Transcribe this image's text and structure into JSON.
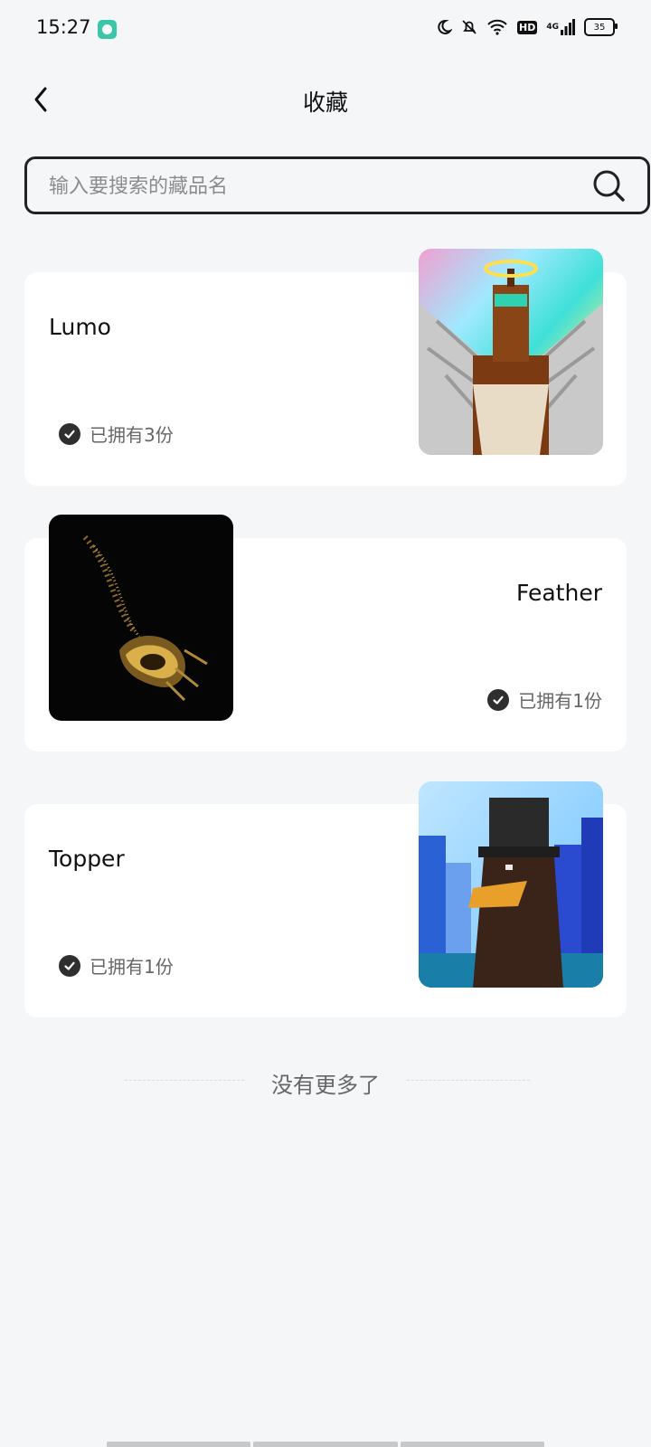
{
  "status_bar": {
    "time": "15:27",
    "network": "4G",
    "hd": "HD",
    "battery": "35"
  },
  "header": {
    "title": "收藏"
  },
  "search": {
    "placeholder": "输入要搜索的藏品名",
    "value": ""
  },
  "items": [
    {
      "name": "Lumo",
      "owned": "已拥有3份",
      "image": "angel-pixel-art"
    },
    {
      "name": "Feather",
      "owned": "已拥有1份",
      "image": "golden-feather"
    },
    {
      "name": "Topper",
      "owned": "已拥有1份",
      "image": "top-hat-pixel-art"
    }
  ],
  "footer": {
    "end_text": "没有更多了"
  },
  "colors": {
    "background": "#f5f6f8",
    "card": "#ffffff",
    "check": "#2f2f2f",
    "muted_text": "#666666"
  }
}
